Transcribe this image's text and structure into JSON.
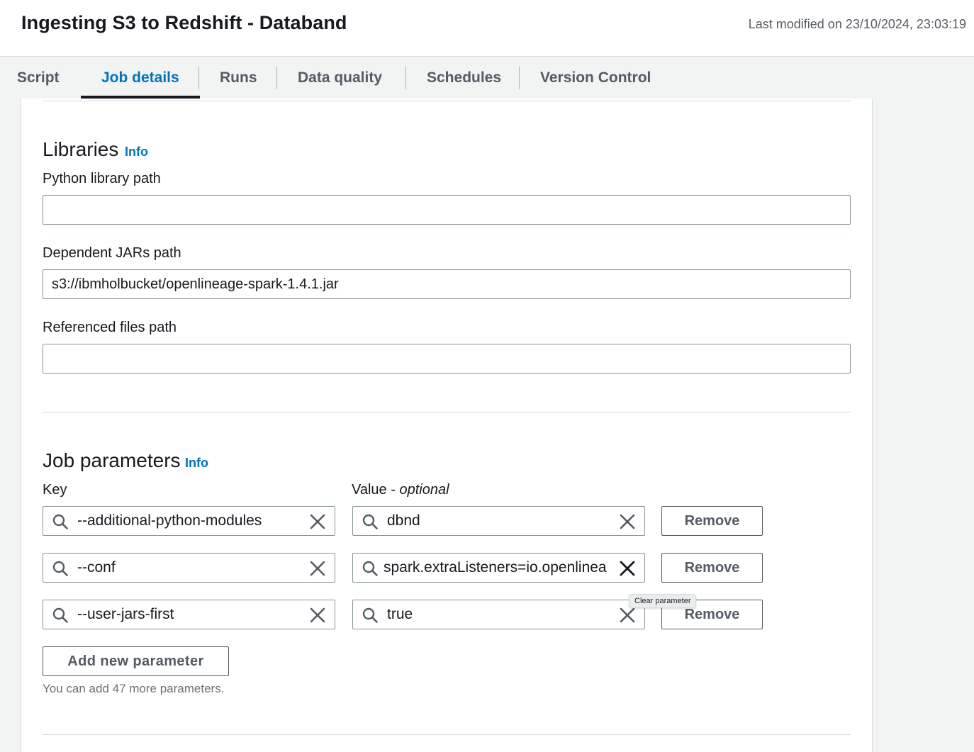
{
  "header": {
    "title": "Ingesting S3 to Redshift - Databand",
    "last_modified": "Last modified on 23/10/2024, 23:03:19"
  },
  "tabs": [
    {
      "label": "Script",
      "active": false
    },
    {
      "label": "Job details",
      "active": true
    },
    {
      "label": "Runs",
      "active": false
    },
    {
      "label": "Data quality",
      "active": false
    },
    {
      "label": "Schedules",
      "active": false
    },
    {
      "label": "Version Control",
      "active": false
    }
  ],
  "libraries": {
    "title": "Libraries",
    "info_label": "Info",
    "python_library_path": {
      "label": "Python library path",
      "value": ""
    },
    "dependent_jars_path": {
      "label": "Dependent JARs path",
      "value": "s3://ibmholbucket/openlineage-spark-1.4.1.jar"
    },
    "referenced_files_path": {
      "label": "Referenced files path",
      "value": ""
    }
  },
  "job_parameters": {
    "title": "Job parameters",
    "info_label": "Info",
    "key_label": "Key",
    "value_label": "Value - ",
    "value_optional": "optional",
    "remove_label": "Remove",
    "rows": [
      {
        "key": "--additional-python-modules",
        "value": "dbnd"
      },
      {
        "key": "--conf",
        "value": "spark.extraListeners=io.openlinea"
      },
      {
        "key": "--user-jars-first",
        "value": "true"
      }
    ],
    "add_button": "Add new parameter",
    "hint": "You can add 47 more parameters.",
    "tooltip": "Clear parameter"
  },
  "colors": {
    "link": "#0073bb",
    "text": "#16191f",
    "muted": "#545b64",
    "border": "#879596",
    "background": "#f2f3f3"
  },
  "icons": {
    "search": "search-icon",
    "clear": "close-icon"
  }
}
